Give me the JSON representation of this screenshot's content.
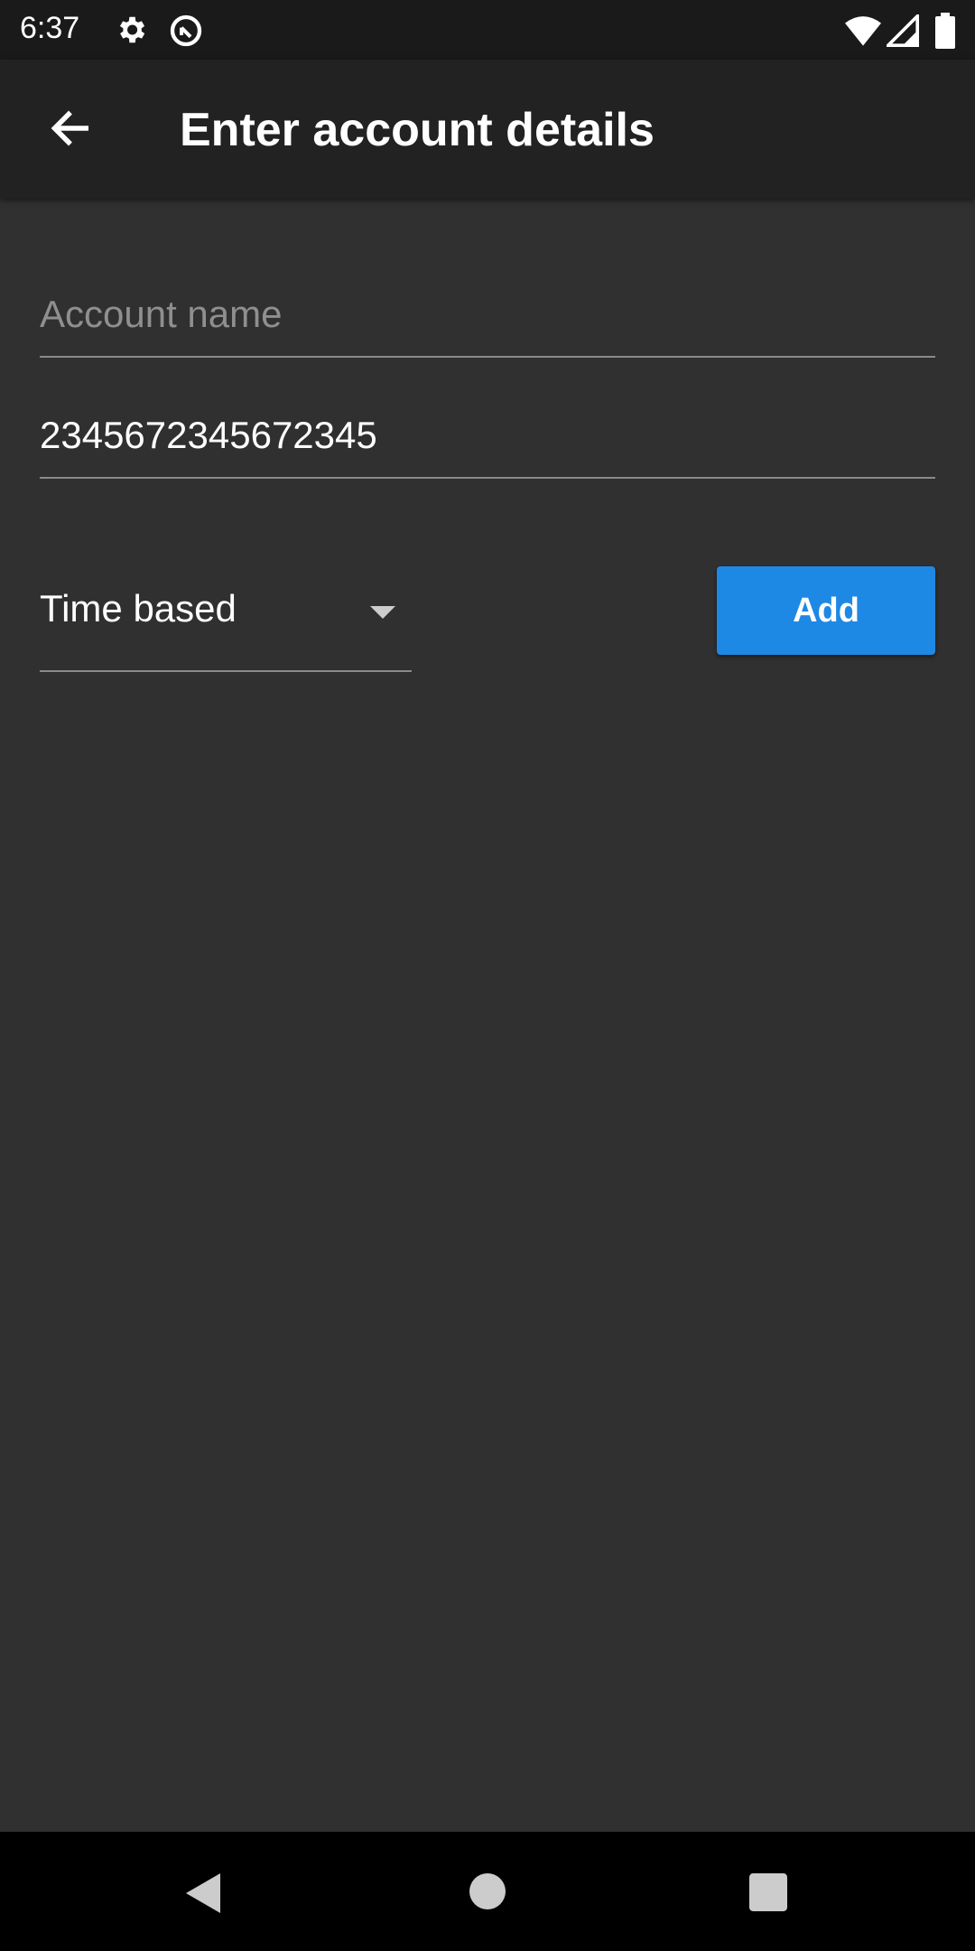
{
  "status_bar": {
    "time": "6:37",
    "icons": [
      "gear-icon",
      "data-saver-icon",
      "wifi-icon",
      "signal-icon",
      "battery-icon"
    ]
  },
  "app_bar": {
    "title": "Enter account details",
    "back_icon": "arrow-back-icon"
  },
  "form": {
    "account_name": {
      "placeholder": "Account name",
      "value": ""
    },
    "secret": {
      "value": "2345672345672345"
    },
    "type_dropdown": {
      "selected": "Time based"
    },
    "add_label": "Add"
  },
  "colors": {
    "accent": "#1e88e5",
    "background": "#303030",
    "app_bar": "#222222"
  },
  "nav_bar": {
    "buttons": [
      "back",
      "home",
      "recents"
    ]
  }
}
